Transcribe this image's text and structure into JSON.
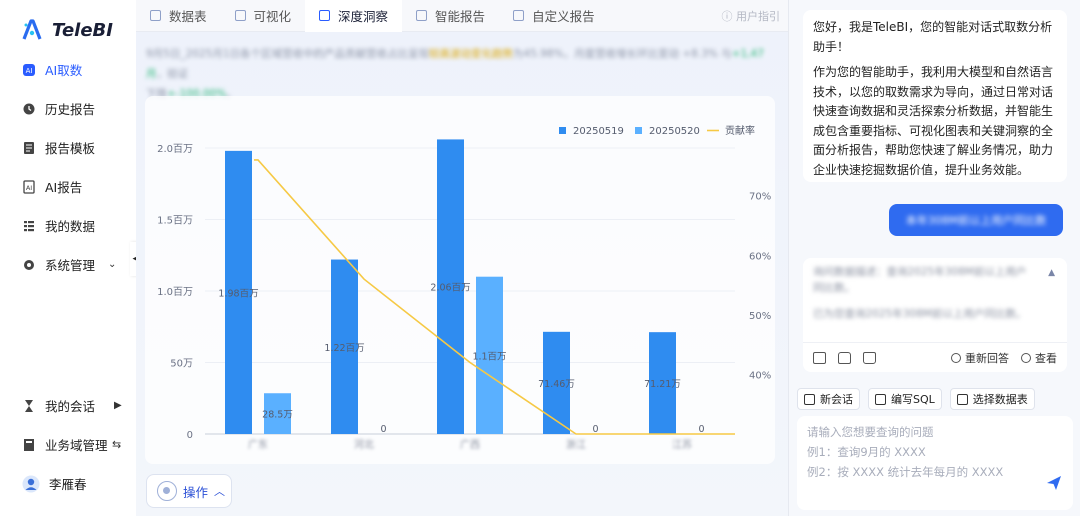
{
  "app": {
    "name": "TeleBI"
  },
  "sidebar": {
    "items": [
      {
        "label": "AI取数",
        "icon": "ai-icon",
        "active": true
      },
      {
        "label": "历史报告",
        "icon": "clock-icon"
      },
      {
        "label": "报告模板",
        "icon": "template-icon"
      },
      {
        "label": "AI报告",
        "icon": "ai-report-icon"
      },
      {
        "label": "我的数据",
        "icon": "data-list-icon"
      },
      {
        "label": "系统管理",
        "icon": "settings-icon"
      }
    ],
    "bottom": [
      {
        "label": "我的会话",
        "icon": "hourglass-icon"
      },
      {
        "label": "业务域管理",
        "icon": "domain-icon"
      },
      {
        "label": "李雁春",
        "icon": "avatar"
      }
    ]
  },
  "tabs": [
    {
      "label": "数据表"
    },
    {
      "label": "可视化"
    },
    {
      "label": "深度洞察",
      "active": true
    },
    {
      "label": "智能报告"
    },
    {
      "label": "自定义报告"
    }
  ],
  "help_label": "用户指引",
  "summary": {
    "line1_a": "9月5日_2025月1日各个区域营收中的产品贡献营收占比呈现",
    "line1_hl": "较高波动变化趋势",
    "line1_b": "为45.98%，月度营收增长环比变动 +8.3% 与",
    "line1_gr": "+1,47 月",
    "line1_c": "，验证",
    "line2_a": "下降",
    "line2_gr": "+-100.00%",
    "line2_b": "。"
  },
  "chart_data": {
    "type": "bar",
    "categories": [
      "广东",
      "河北",
      "广西",
      "浙江",
      "江苏"
    ],
    "series": [
      {
        "name": "20250519",
        "values": [
          1.98,
          1.22,
          2.06,
          0.7146,
          0.7121
        ],
        "color": "#2f8cf0",
        "labels": [
          "1.98百万",
          "1.22百万",
          "2.06百万",
          "71.46万",
          "71.21万"
        ]
      },
      {
        "name": "20250520",
        "values": [
          0.285,
          0,
          1.1,
          0,
          0
        ],
        "color": "#5ab0ff",
        "labels": [
          "28.5万",
          "0",
          "1.1百万",
          "0",
          "0"
        ]
      }
    ],
    "line": {
      "name": "贡献率",
      "color": "#f6c945",
      "points": [
        76,
        56,
        42,
        30,
        30
      ]
    },
    "yleft_ticks": [
      "0",
      "50万",
      "1.0百万",
      "1.5百万",
      "2.0百万"
    ],
    "yleft_max": 2.0,
    "yright_ticks": [
      "40%",
      "50%",
      "60%",
      "70%"
    ],
    "yright_range": [
      30,
      78
    ],
    "legend_position": "top-right"
  },
  "operate_label": "操作",
  "chat": {
    "ai_greeting": "您好，我是TeleBI，您的智能对话式取数分析助手！",
    "ai_intro": "作为您的智能助手，我利用大模型和自然语言技术，以您的取数需求为导向，通过日常对话快速查询数据和灵活探索分析数据，并智能生成包含重要指标、可视化图表和关键洞察的全面分析报告，帮助您快速了解业务情况，助力企业快速挖掘数据价值，提升业务效能。",
    "user_question": "本年308M前以上用户同比数",
    "answer_line1": "询问数据描述：查询2025年308M前以上用户同比数。",
    "answer_line2": "已为您查询2025年308M前以上用户同比数。",
    "regenerate_label": "重新回答",
    "view_label": "查看"
  },
  "quick_actions": [
    {
      "label": "新会话",
      "icon": "new-chat-icon"
    },
    {
      "label": "编写SQL",
      "icon": "sql-icon"
    },
    {
      "label": "选择数据表",
      "icon": "table-select-icon"
    }
  ],
  "input": {
    "placeholder_line1": "请输入您想要查询的问题",
    "placeholder_line2": "例1：查询9月的 XXXX",
    "placeholder_line3": "例2：按 XXXX 统计去年每月的 XXXX"
  }
}
